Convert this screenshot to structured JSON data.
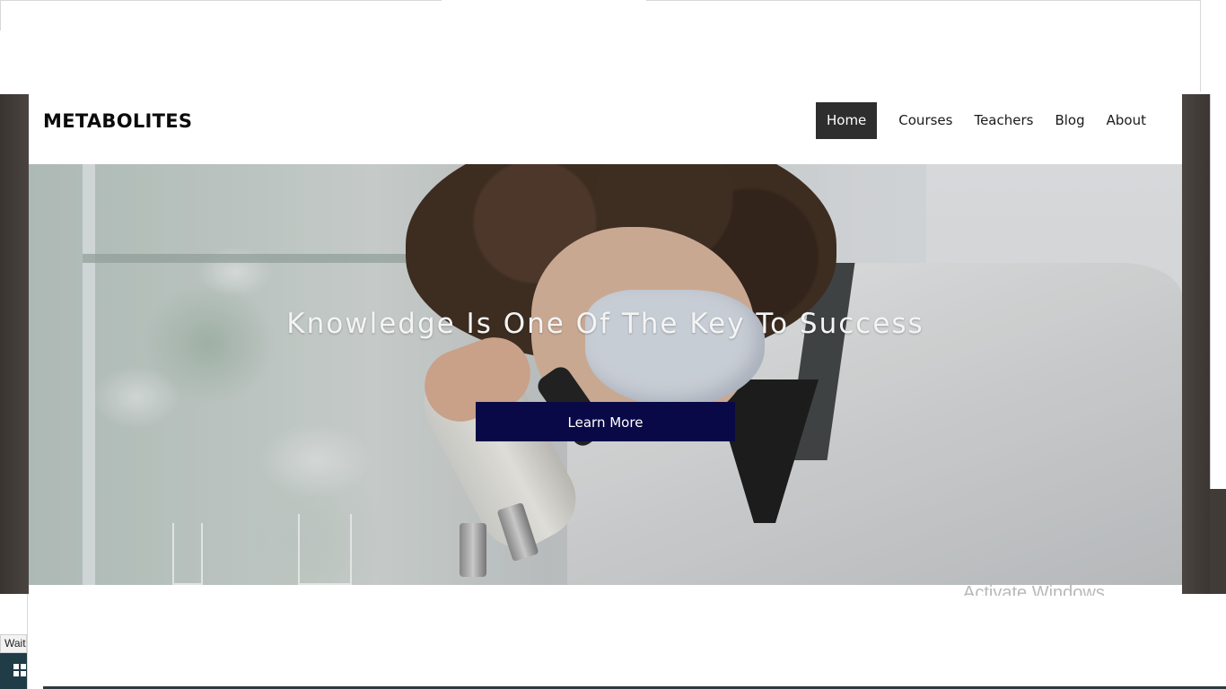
{
  "site": {
    "logo": "METABOLITES",
    "nav": [
      {
        "label": "Home",
        "active": true
      },
      {
        "label": "Courses",
        "active": false
      },
      {
        "label": "Teachers",
        "active": false
      },
      {
        "label": "Blog",
        "active": false
      },
      {
        "label": "About",
        "active": false
      }
    ]
  },
  "hero": {
    "title": "Knowledge Is One Of The Key To Success",
    "button_label": "Learn More"
  },
  "os": {
    "watermark": "Activate Windows",
    "status_text": "Wait"
  },
  "colors": {
    "nav_active_bg": "#2e2e2e",
    "button_bg": "#0a0947",
    "hero_text": "#f4f4f4"
  },
  "icons": [
    "windows-start-icon"
  ]
}
